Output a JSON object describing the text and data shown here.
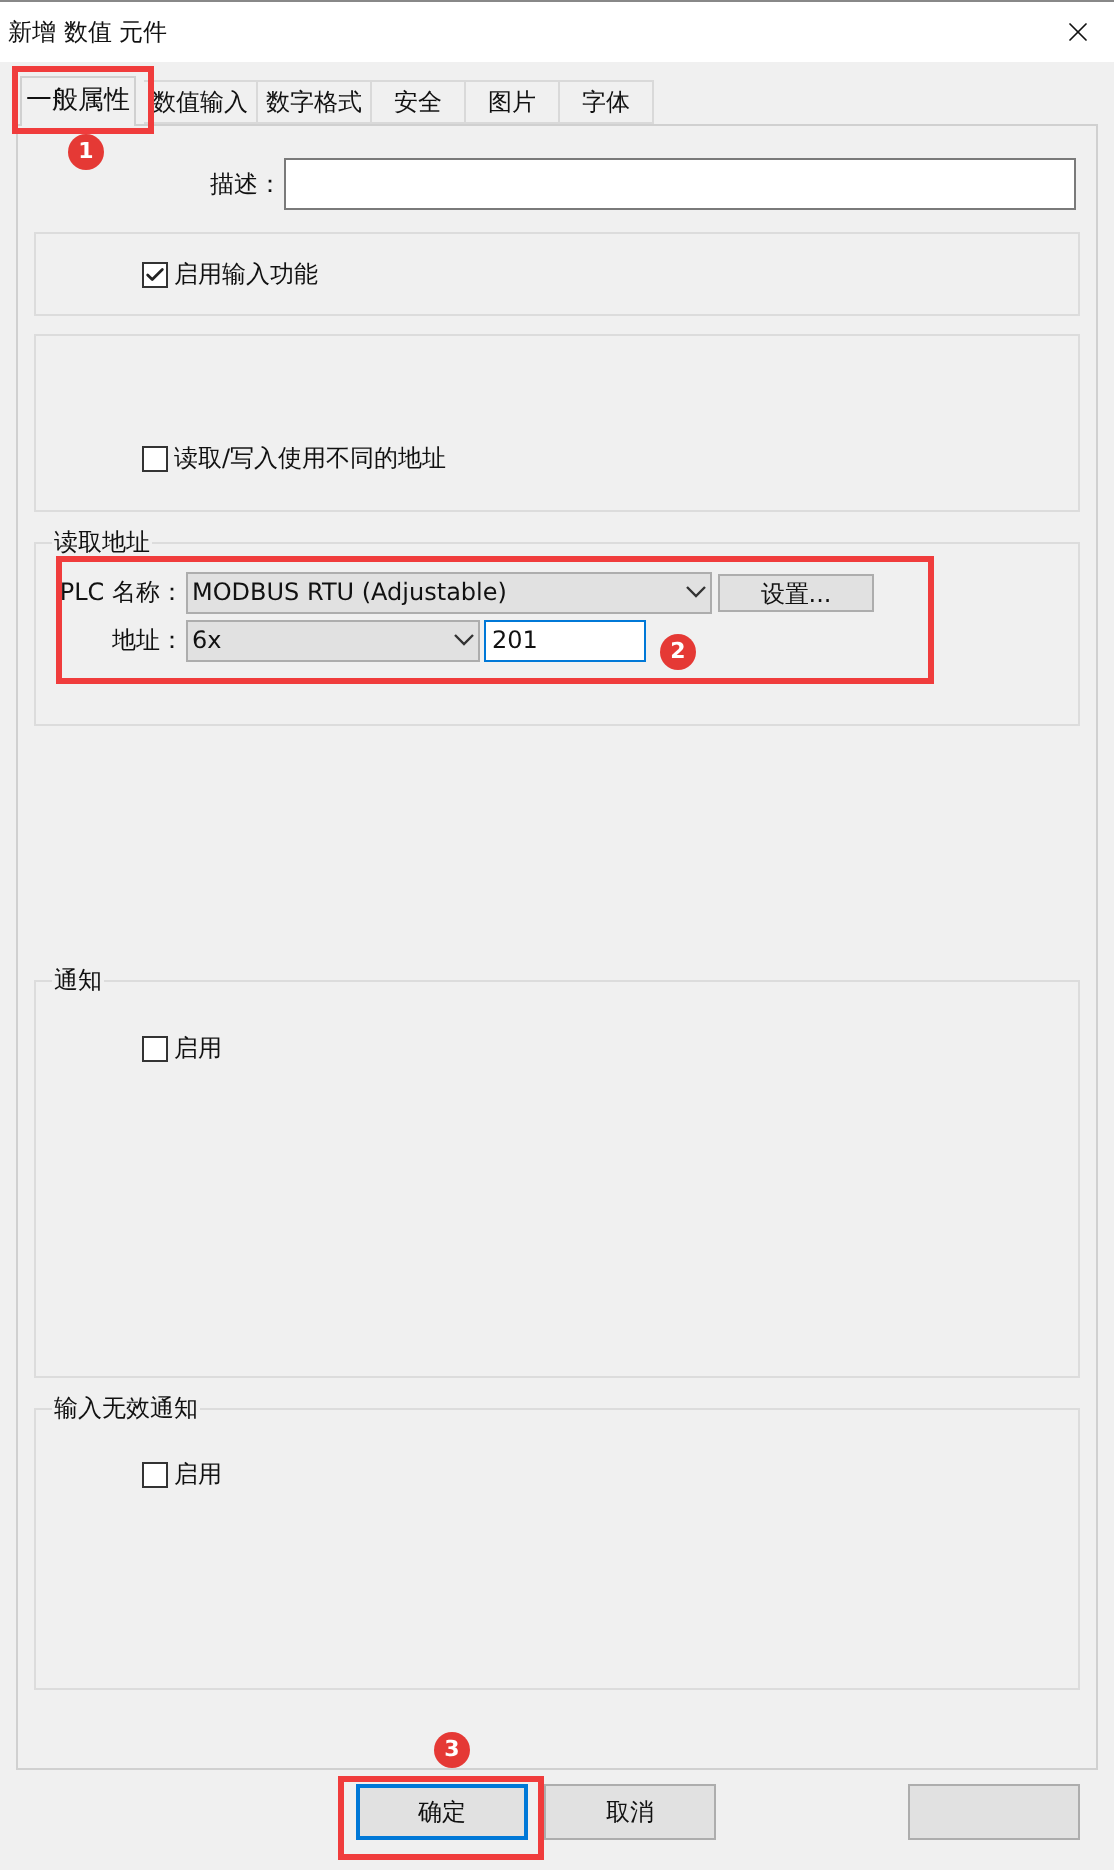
{
  "window": {
    "title": "新增 数值 元件"
  },
  "tabs": [
    {
      "label": "一般属性",
      "selected": true
    },
    {
      "label": "数值输入",
      "selected": false
    },
    {
      "label": "数字格式",
      "selected": false
    },
    {
      "label": "安全",
      "selected": false
    },
    {
      "label": "图片",
      "selected": false
    },
    {
      "label": "字体",
      "selected": false
    }
  ],
  "description": {
    "label": "描述："
  },
  "input_function": {
    "label": "启用输入功能",
    "checked": true
  },
  "separate_address": {
    "label": "读取/写入使用不同的地址",
    "checked": false
  },
  "read_address": {
    "title": "读取地址",
    "plc_label": "PLC 名称：",
    "plc_value": "MODBUS RTU (Adjustable)",
    "settings_button": "设置...",
    "address_label": "地址：",
    "address_type": "6x",
    "address_value": "201"
  },
  "notify": {
    "title": "通知",
    "enable": {
      "label": "启用",
      "checked": false
    }
  },
  "invalid_notify": {
    "title": "输入无效通知",
    "enable": {
      "label": "启用",
      "checked": false
    }
  },
  "buttons": [
    {
      "label": "确定",
      "focused": true
    },
    {
      "label": "取消",
      "focused": false
    }
  ],
  "annotations": [
    {
      "number": "1"
    },
    {
      "number": "2"
    },
    {
      "number": "3"
    }
  ]
}
